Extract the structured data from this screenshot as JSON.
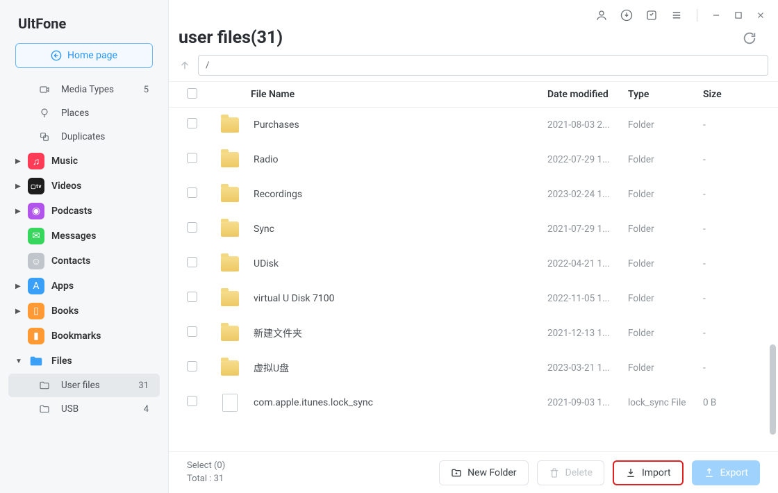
{
  "app_name": "UltFone",
  "home_button_label": "Home page",
  "sidebar": {
    "simple_items": [
      {
        "icon": "video",
        "label": "Media Types",
        "count": "5"
      },
      {
        "icon": "pin",
        "label": "Places",
        "count": ""
      },
      {
        "icon": "dup",
        "label": "Duplicates",
        "count": ""
      }
    ],
    "app_items": [
      {
        "caret": true,
        "bg": "#fc3b57",
        "glyph": "♫",
        "label": "Music"
      },
      {
        "caret": true,
        "bg": "#1d1d1d",
        "glyph": "tv",
        "label": "Videos"
      },
      {
        "caret": true,
        "bg": "#b154eb",
        "glyph": "◉",
        "label": "Podcasts"
      },
      {
        "caret": false,
        "bg": "#37d65d",
        "glyph": "✉",
        "label": "Messages"
      },
      {
        "caret": false,
        "bg": "#bfc5ca",
        "glyph": "☺",
        "label": "Contacts"
      },
      {
        "caret": true,
        "bg": "#3a9ff6",
        "glyph": "A",
        "label": "Apps"
      },
      {
        "caret": true,
        "bg": "#ff9933",
        "glyph": "▯",
        "label": "Books"
      },
      {
        "caret": false,
        "bg": "#ff9933",
        "glyph": "▮",
        "label": "Bookmarks"
      }
    ],
    "files_section": {
      "label": "Files",
      "children": [
        {
          "icon": "folder",
          "label": "User files",
          "count": "31",
          "active": true
        },
        {
          "icon": "folder",
          "label": "USB",
          "count": "4",
          "active": false
        }
      ]
    }
  },
  "page_title": "user files(31)",
  "path_value": "/",
  "columns": {
    "name": "File Name",
    "date": "Date modified",
    "type": "Type",
    "size": "Size"
  },
  "rows": [
    {
      "kind": "folder",
      "name": "Purchases",
      "date": "2021-08-03 2...",
      "type": "Folder",
      "size": "-"
    },
    {
      "kind": "folder",
      "name": "Radio",
      "date": "2022-07-29 1...",
      "type": "Folder",
      "size": "-"
    },
    {
      "kind": "folder",
      "name": "Recordings",
      "date": "2023-02-24 1...",
      "type": "Folder",
      "size": "-"
    },
    {
      "kind": "folder",
      "name": "Sync",
      "date": "2021-07-29 1...",
      "type": "Folder",
      "size": "-"
    },
    {
      "kind": "folder",
      "name": "UDisk",
      "date": "2022-04-21 1...",
      "type": "Folder",
      "size": "-"
    },
    {
      "kind": "folder",
      "name": "virtual U Disk 7100",
      "date": "2022-11-05 1...",
      "type": "Folder",
      "size": "-"
    },
    {
      "kind": "folder",
      "name": "新建文件夹",
      "date": "2021-12-13 1...",
      "type": "Folder",
      "size": "-"
    },
    {
      "kind": "folder",
      "name": "虚拟U盘",
      "date": "2023-03-21 1...",
      "type": "Folder",
      "size": "-"
    },
    {
      "kind": "file",
      "name": "com.apple.itunes.lock_sync",
      "date": "2021-09-03 1...",
      "type": "lock_sync File",
      "size": "0 B"
    }
  ],
  "footer": {
    "select_label": "Select (0)",
    "total_label": "Total : 31",
    "new_folder": "New Folder",
    "delete": "Delete",
    "import": "Import",
    "export": "Export"
  }
}
